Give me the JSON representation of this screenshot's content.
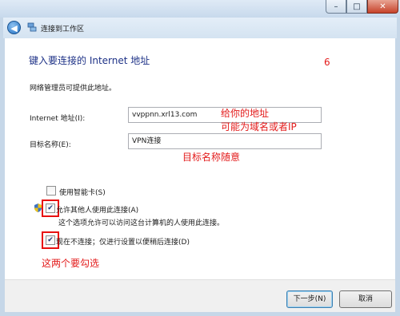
{
  "window": {
    "title": "连接到工作区",
    "min_symbol": "–",
    "max_symbol": "□",
    "close_symbol": "✕",
    "back_symbol": "◀"
  },
  "page": {
    "heading": "键入要连接的 Internet 地址",
    "description": "网络管理员可提供此地址。",
    "address_label": "Internet 地址(I):",
    "address_value": "vvppnn.xrl13.com",
    "name_label": "目标名称(E):",
    "name_value": "VPN连接",
    "smartcard_label": "使用智能卡(S)",
    "smartcard_checked": false,
    "allow_label": "允许其他人使用此连接(A)",
    "allow_checked": true,
    "allow_desc": "这个选项允许可以访问这台计算机的人使用此连接。",
    "dontconnect_label": "现在不连接；仅进行设置以便稍后连接(D)",
    "dontconnect_checked": true
  },
  "annotations": {
    "step_number": "6",
    "address_note": "给你的地址",
    "address_note2": "可能为域名或者IP",
    "name_note": "目标名称随意",
    "check_note": "这两个要勾选"
  },
  "footer": {
    "next_label": "下一步(N)",
    "cancel_label": "取消"
  },
  "colors": {
    "heading": "#1e3287",
    "annotation": "#e31b1b",
    "highlight_box": "#e81010"
  },
  "icons": [
    "network-icon",
    "shield-icon",
    "back-arrow-icon"
  ]
}
